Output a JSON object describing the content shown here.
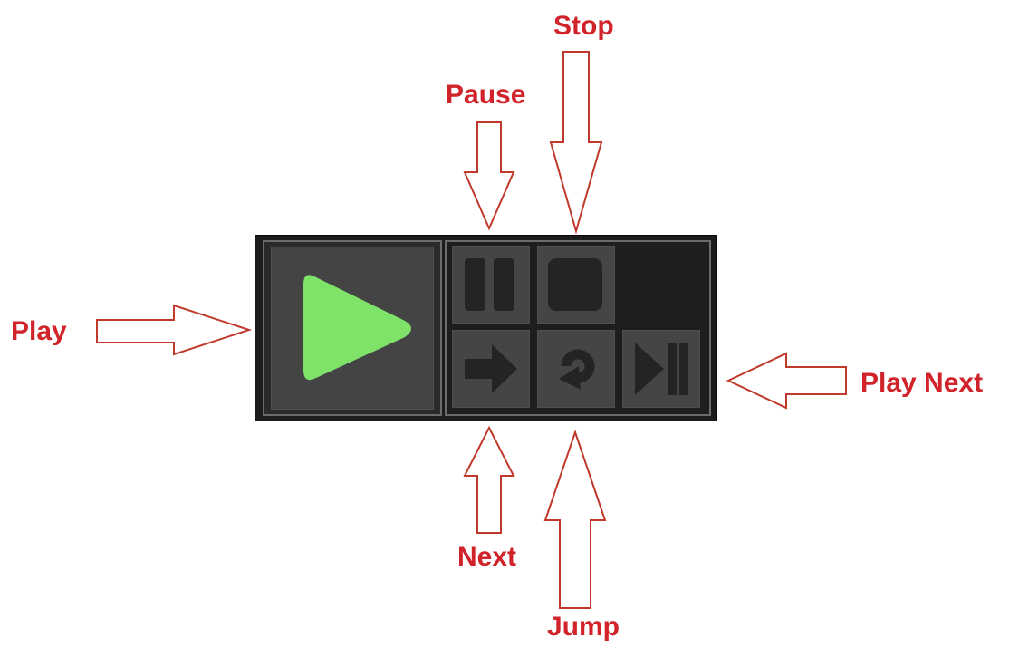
{
  "callouts": {
    "stop": "Stop",
    "pause": "Pause",
    "play": "Play",
    "play_next": "Play Next",
    "next": "Next",
    "jump": "Jump"
  },
  "controls": {
    "play": {
      "icon": "play-icon",
      "color": "#7fe36a"
    },
    "pause": {
      "icon": "pause-icon"
    },
    "stop": {
      "icon": "stop-icon"
    },
    "next": {
      "icon": "arrow-right-icon"
    },
    "jump": {
      "icon": "rotate-icon"
    },
    "play_next": {
      "icon": "play-next-icon"
    }
  },
  "colors": {
    "callout_text": "#d0232a",
    "callout_arrow": "#c0392b",
    "panel_background": "#1c1c1c",
    "button_background": "#454545",
    "icon_color": "#242424"
  }
}
